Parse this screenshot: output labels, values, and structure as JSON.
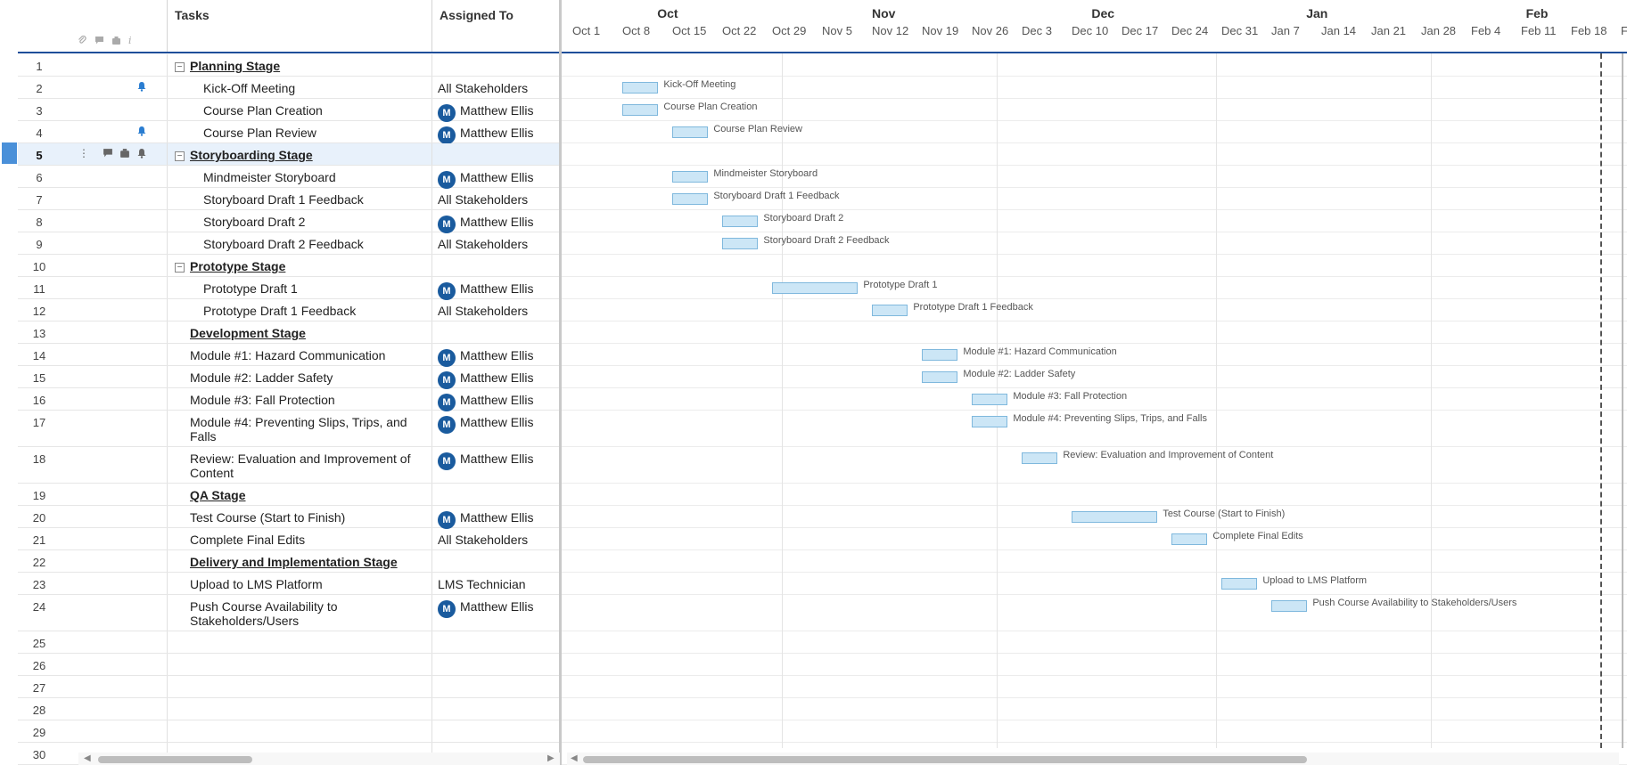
{
  "grid": {
    "columns": {
      "tasks": "Tasks",
      "assigned": "Assigned To"
    },
    "header_icons": [
      "attachment-icon",
      "comment-icon",
      "proof-icon",
      "info-icon"
    ],
    "rows": [
      {
        "num": "1",
        "task": "Planning Stage",
        "assigned": "",
        "level": 0,
        "bold": true,
        "collapse": true,
        "h": 25
      },
      {
        "num": "2",
        "task": "Kick-Off Meeting",
        "assigned": "All Stakeholders",
        "level": 1,
        "avatar": false,
        "reminder": true,
        "h": 25
      },
      {
        "num": "3",
        "task": "Course Plan Creation",
        "assigned": "Matthew Ellis",
        "level": 1,
        "avatar": true,
        "h": 25
      },
      {
        "num": "4",
        "task": "Course Plan Review",
        "assigned": "Matthew Ellis",
        "level": 1,
        "avatar": true,
        "reminder": true,
        "h": 25
      },
      {
        "num": "5",
        "task": "Storyboarding Stage",
        "assigned": "",
        "level": 0,
        "bold": true,
        "collapse": true,
        "selected": true,
        "h": 25
      },
      {
        "num": "6",
        "task": "Mindmeister Storyboard",
        "assigned": "Matthew Ellis",
        "level": 1,
        "avatar": true,
        "h": 25
      },
      {
        "num": "7",
        "task": "Storyboard Draft 1 Feedback",
        "assigned": "All Stakeholders",
        "level": 1,
        "h": 25
      },
      {
        "num": "8",
        "task": "Storyboard Draft 2",
        "assigned": "Matthew Ellis",
        "level": 1,
        "avatar": true,
        "h": 25
      },
      {
        "num": "9",
        "task": "Storyboard Draft 2 Feedback",
        "assigned": "All Stakeholders",
        "level": 1,
        "h": 25
      },
      {
        "num": "10",
        "task": "Prototype Stage",
        "assigned": "",
        "level": 0,
        "bold": true,
        "collapse": true,
        "h": 25
      },
      {
        "num": "11",
        "task": "Prototype Draft 1",
        "assigned": "Matthew Ellis",
        "level": 1,
        "avatar": true,
        "h": 25
      },
      {
        "num": "12",
        "task": "Prototype Draft 1 Feedback",
        "assigned": "All Stakeholders",
        "level": 1,
        "h": 25
      },
      {
        "num": "13",
        "task": "Development Stage",
        "assigned": "",
        "level": 0,
        "bold": true,
        "h": 25
      },
      {
        "num": "14",
        "task": "Module #1: Hazard Communication",
        "assigned": "Matthew Ellis",
        "level": 0,
        "avatar": true,
        "h": 25
      },
      {
        "num": "15",
        "task": "Module #2: Ladder Safety",
        "assigned": "Matthew Ellis",
        "level": 0,
        "avatar": true,
        "h": 25
      },
      {
        "num": "16",
        "task": "Module #3: Fall Protection",
        "assigned": "Matthew Ellis",
        "level": 0,
        "avatar": true,
        "h": 25
      },
      {
        "num": "17",
        "task": "Module #4: Preventing Slips, Trips, and Falls",
        "assigned": "Matthew Ellis",
        "level": 0,
        "avatar": true,
        "h": 41
      },
      {
        "num": "18",
        "task": "Review: Evaluation and Improvement of Content",
        "assigned": "Matthew Ellis",
        "level": 0,
        "avatar": true,
        "h": 41
      },
      {
        "num": "19",
        "task": "QA Stage",
        "assigned": "",
        "level": 0,
        "bold": true,
        "h": 25
      },
      {
        "num": "20",
        "task": "Test Course (Start to Finish)",
        "assigned": "Matthew Ellis",
        "level": 0,
        "avatar": true,
        "h": 25
      },
      {
        "num": "21",
        "task": "Complete Final Edits",
        "assigned": "All Stakeholders",
        "level": 0,
        "h": 25
      },
      {
        "num": "22",
        "task": "Delivery and Implementation Stage",
        "assigned": "",
        "level": 0,
        "bold": true,
        "h": 25
      },
      {
        "num": "23",
        "task": "Upload to LMS Platform",
        "assigned": "LMS Technician",
        "level": 0,
        "h": 25
      },
      {
        "num": "24",
        "task": "Push Course Availability to Stakeholders/Users",
        "assigned": "Matthew Ellis",
        "level": 0,
        "avatar": true,
        "h": 41
      },
      {
        "num": "25",
        "task": "",
        "assigned": "",
        "level": 0,
        "h": 25
      },
      {
        "num": "26",
        "task": "",
        "assigned": "",
        "level": 0,
        "h": 25
      },
      {
        "num": "27",
        "task": "",
        "assigned": "",
        "level": 0,
        "h": 25
      },
      {
        "num": "28",
        "task": "",
        "assigned": "",
        "level": 0,
        "h": 25
      },
      {
        "num": "29",
        "task": "",
        "assigned": "",
        "level": 0,
        "h": 25
      },
      {
        "num": "30",
        "task": "",
        "assigned": "",
        "level": 0,
        "h": 25
      }
    ],
    "avatar_letter": "M"
  },
  "gantt": {
    "months": [
      "Oct",
      "Nov",
      "Dec",
      "Jan",
      "Feb"
    ],
    "weeks": [
      "Oct 1",
      "Oct 8",
      "Oct 15",
      "Oct 22",
      "Oct 29",
      "Nov 5",
      "Nov 12",
      "Nov 19",
      "Nov 26",
      "Dec 3",
      "Dec 10",
      "Dec 17",
      "Dec 24",
      "Dec 31",
      "Jan 7",
      "Jan 14",
      "Jan 21",
      "Jan 28",
      "Feb 4",
      "Feb 11",
      "Feb 18",
      "Fe"
    ],
    "bars": [
      {
        "row": 2,
        "start": 1,
        "weeks": 0.72,
        "label": "Kick-Off Meeting"
      },
      {
        "row": 3,
        "start": 1,
        "weeks": 0.72,
        "label": "Course Plan Creation"
      },
      {
        "row": 4,
        "start": 2,
        "weeks": 0.72,
        "label": "Course Plan Review"
      },
      {
        "row": 6,
        "start": 2,
        "weeks": 0.72,
        "label": "Mindmeister Storyboard"
      },
      {
        "row": 7,
        "start": 2,
        "weeks": 0.72,
        "label": "Storyboard Draft 1 Feedback"
      },
      {
        "row": 8,
        "start": 3,
        "weeks": 0.72,
        "label": "Storyboard Draft 2"
      },
      {
        "row": 9,
        "start": 3,
        "weeks": 0.72,
        "label": "Storyboard Draft 2 Feedback"
      },
      {
        "row": 11,
        "start": 4,
        "weeks": 1.72,
        "label": "Prototype Draft 1"
      },
      {
        "row": 12,
        "start": 6,
        "weeks": 0.72,
        "label": "Prototype Draft 1 Feedback"
      },
      {
        "row": 14,
        "start": 7,
        "weeks": 0.72,
        "label": "Module #1: Hazard Communication"
      },
      {
        "row": 15,
        "start": 7,
        "weeks": 0.72,
        "label": "Module #2: Ladder Safety"
      },
      {
        "row": 16,
        "start": 8,
        "weeks": 0.72,
        "label": "Module #3: Fall Protection"
      },
      {
        "row": 17,
        "start": 8,
        "weeks": 0.72,
        "label": "Module #4: Preventing Slips, Trips, and Falls"
      },
      {
        "row": 18,
        "start": 9,
        "weeks": 0.72,
        "label": "Review: Evaluation and Improvement of Content"
      },
      {
        "row": 20,
        "start": 10,
        "weeks": 1.72,
        "label": "Test Course (Start to Finish)"
      },
      {
        "row": 21,
        "start": 12,
        "weeks": 0.72,
        "label": "Complete Final Edits"
      },
      {
        "row": 23,
        "start": 13,
        "weeks": 0.72,
        "label": "Upload to LMS Platform"
      },
      {
        "row": 24,
        "start": 14,
        "weeks": 0.72,
        "label": "Push Course Availability to Stakeholders/Users"
      }
    ],
    "month_boundaries": [
      4.3,
      8.6,
      13,
      17.3
    ],
    "month_label_weeks": [
      1.7,
      6.0,
      10.4,
      14.7,
      19.1
    ],
    "today_week": 20.7
  }
}
